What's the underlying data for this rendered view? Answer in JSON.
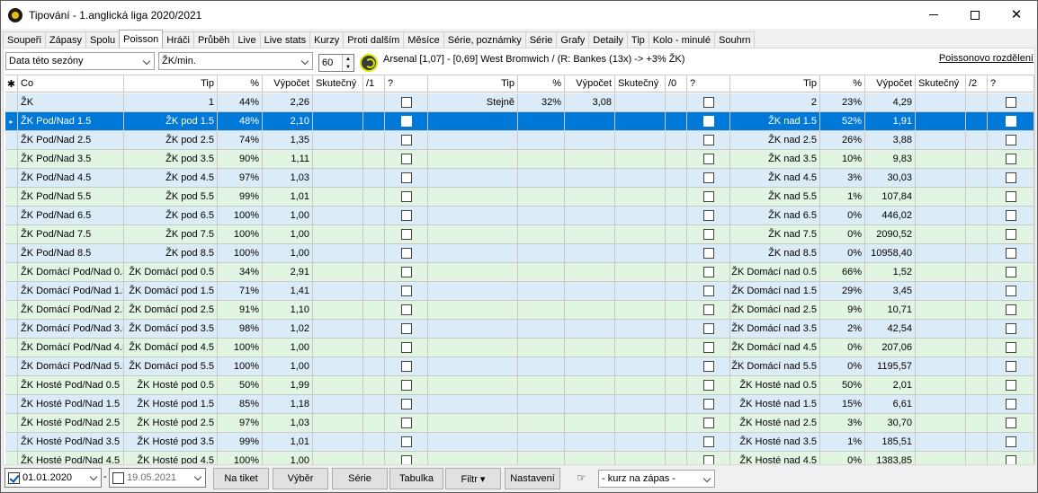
{
  "window": {
    "title": "Tipování - 1.anglická liga 2020/2021",
    "min": "–",
    "close": "✕"
  },
  "tabs": [
    "Soupeři",
    "Zápasy",
    "Spolu",
    "Poisson",
    "Hráči",
    "Průběh",
    "Live",
    "Live stats",
    "Kurzy",
    "Proti dalším",
    "Měsíce",
    "Série, poznámky",
    "Série",
    "Grafy",
    "Detaily",
    "Tip",
    "Kolo - minulé",
    "Souhrn"
  ],
  "active_tab": "Poisson",
  "toolbar": {
    "season_combo": "Data této sezóny",
    "metric_combo": "ŽK/min.",
    "minutes": "60",
    "match_info": "Arsenal [1,07] - [0,69] West Bromwich   / (R: Bankes (13x) -> +3% ŽK)",
    "poisson_link": "Poissonovo rozdělení"
  },
  "columns": [
    "Co",
    "Tip",
    "%",
    "Výpočet",
    "Skutečný",
    "/1",
    "?",
    "Tip",
    "%",
    "Výpočet",
    "Skutečný",
    "/0",
    "?",
    "Tip",
    "%",
    "Výpočet",
    "Skutečný",
    "/2",
    "?"
  ],
  "header_marker": "✱",
  "row_marker": "▸",
  "rows": [
    {
      "co": "ŽK",
      "tip1": "1",
      "p1": "44%",
      "v1": "2,26",
      "tip0": "Stejně",
      "p0": "32%",
      "v0": "3,08",
      "tip2": "2",
      "p2": "23%",
      "v2": "4,29",
      "sel": false
    },
    {
      "co": "ŽK Pod/Nad 1.5",
      "tip1": "ŽK pod 1.5",
      "p1": "48%",
      "v1": "2,10",
      "tip0": "",
      "p0": "",
      "v0": "",
      "tip2": "ŽK nad 1.5",
      "p2": "52%",
      "v2": "1,91",
      "sel": true
    },
    {
      "co": "ŽK Pod/Nad 2.5",
      "tip1": "ŽK pod 2.5",
      "p1": "74%",
      "v1": "1,35",
      "tip0": "",
      "p0": "",
      "v0": "",
      "tip2": "ŽK nad 2.5",
      "p2": "26%",
      "v2": "3,88",
      "sel": false
    },
    {
      "co": "ŽK Pod/Nad 3.5",
      "tip1": "ŽK pod 3.5",
      "p1": "90%",
      "v1": "1,11",
      "tip0": "",
      "p0": "",
      "v0": "",
      "tip2": "ŽK nad 3.5",
      "p2": "10%",
      "v2": "9,83",
      "sel": false
    },
    {
      "co": "ŽK Pod/Nad 4.5",
      "tip1": "ŽK pod 4.5",
      "p1": "97%",
      "v1": "1,03",
      "tip0": "",
      "p0": "",
      "v0": "",
      "tip2": "ŽK nad 4.5",
      "p2": "3%",
      "v2": "30,03",
      "sel": false
    },
    {
      "co": "ŽK Pod/Nad 5.5",
      "tip1": "ŽK pod 5.5",
      "p1": "99%",
      "v1": "1,01",
      "tip0": "",
      "p0": "",
      "v0": "",
      "tip2": "ŽK nad 5.5",
      "p2": "1%",
      "v2": "107,84",
      "sel": false
    },
    {
      "co": "ŽK Pod/Nad 6.5",
      "tip1": "ŽK pod 6.5",
      "p1": "100%",
      "v1": "1,00",
      "tip0": "",
      "p0": "",
      "v0": "",
      "tip2": "ŽK nad 6.5",
      "p2": "0%",
      "v2": "446,02",
      "sel": false
    },
    {
      "co": "ŽK Pod/Nad 7.5",
      "tip1": "ŽK pod 7.5",
      "p1": "100%",
      "v1": "1,00",
      "tip0": "",
      "p0": "",
      "v0": "",
      "tip2": "ŽK nad 7.5",
      "p2": "0%",
      "v2": "2090,52",
      "sel": false
    },
    {
      "co": "ŽK Pod/Nad 8.5",
      "tip1": "ŽK pod 8.5",
      "p1": "100%",
      "v1": "1,00",
      "tip0": "",
      "p0": "",
      "v0": "",
      "tip2": "ŽK nad 8.5",
      "p2": "0%",
      "v2": "10958,40",
      "sel": false
    },
    {
      "co": "ŽK Domácí Pod/Nad 0.5",
      "tip1": "ŽK Domácí pod 0.5",
      "p1": "34%",
      "v1": "2,91",
      "tip0": "",
      "p0": "",
      "v0": "",
      "tip2": "ŽK Domácí nad 0.5",
      "p2": "66%",
      "v2": "1,52",
      "sel": false
    },
    {
      "co": "ŽK Domácí Pod/Nad 1.5",
      "tip1": "ŽK Domácí pod 1.5",
      "p1": "71%",
      "v1": "1,41",
      "tip0": "",
      "p0": "",
      "v0": "",
      "tip2": "ŽK Domácí nad 1.5",
      "p2": "29%",
      "v2": "3,45",
      "sel": false
    },
    {
      "co": "ŽK Domácí Pod/Nad 2.5",
      "tip1": "ŽK Domácí pod 2.5",
      "p1": "91%",
      "v1": "1,10",
      "tip0": "",
      "p0": "",
      "v0": "",
      "tip2": "ŽK Domácí nad 2.5",
      "p2": "9%",
      "v2": "10,71",
      "sel": false
    },
    {
      "co": "ŽK Domácí Pod/Nad 3.5",
      "tip1": "ŽK Domácí pod 3.5",
      "p1": "98%",
      "v1": "1,02",
      "tip0": "",
      "p0": "",
      "v0": "",
      "tip2": "ŽK Domácí nad 3.5",
      "p2": "2%",
      "v2": "42,54",
      "sel": false
    },
    {
      "co": "ŽK Domácí Pod/Nad 4.5",
      "tip1": "ŽK Domácí pod 4.5",
      "p1": "100%",
      "v1": "1,00",
      "tip0": "",
      "p0": "",
      "v0": "",
      "tip2": "ŽK Domácí nad 4.5",
      "p2": "0%",
      "v2": "207,06",
      "sel": false
    },
    {
      "co": "ŽK Domácí Pod/Nad 5.5",
      "tip1": "ŽK Domácí pod 5.5",
      "p1": "100%",
      "v1": "1,00",
      "tip0": "",
      "p0": "",
      "v0": "",
      "tip2": "ŽK Domácí nad 5.5",
      "p2": "0%",
      "v2": "1195,57",
      "sel": false
    },
    {
      "co": "ŽK Hosté Pod/Nad 0.5",
      "tip1": "ŽK Hosté pod 0.5",
      "p1": "50%",
      "v1": "1,99",
      "tip0": "",
      "p0": "",
      "v0": "",
      "tip2": "ŽK Hosté nad 0.5",
      "p2": "50%",
      "v2": "2,01",
      "sel": false
    },
    {
      "co": "ŽK Hosté Pod/Nad 1.5",
      "tip1": "ŽK Hosté pod 1.5",
      "p1": "85%",
      "v1": "1,18",
      "tip0": "",
      "p0": "",
      "v0": "",
      "tip2": "ŽK Hosté nad 1.5",
      "p2": "15%",
      "v2": "6,61",
      "sel": false
    },
    {
      "co": "ŽK Hosté Pod/Nad 2.5",
      "tip1": "ŽK Hosté pod 2.5",
      "p1": "97%",
      "v1": "1,03",
      "tip0": "",
      "p0": "",
      "v0": "",
      "tip2": "ŽK Hosté nad 2.5",
      "p2": "3%",
      "v2": "30,70",
      "sel": false
    },
    {
      "co": "ŽK Hosté Pod/Nad 3.5",
      "tip1": "ŽK Hosté pod 3.5",
      "p1": "99%",
      "v1": "1,01",
      "tip0": "",
      "p0": "",
      "v0": "",
      "tip2": "ŽK Hosté nad 3.5",
      "p2": "1%",
      "v2": "185,51",
      "sel": false
    },
    {
      "co": "ŽK Hosté Pod/Nad 4.5",
      "tip1": "ŽK Hosté pod 4.5",
      "p1": "100%",
      "v1": "1,00",
      "tip0": "",
      "p0": "",
      "v0": "",
      "tip2": "ŽK Hosté nad 4.5",
      "p2": "0%",
      "v2": "1383,85",
      "sel": false
    }
  ],
  "bottom": {
    "date_from": "01.01.2020",
    "date_to": "19.05.2021",
    "date_sep": "-",
    "buttons": [
      "Na tiket",
      "Výběr",
      "Série",
      "Tabulka",
      "Filtr ▾",
      "Nastavení"
    ],
    "hand_icon": "☞",
    "odds_combo": "- kurz na zápas -"
  }
}
